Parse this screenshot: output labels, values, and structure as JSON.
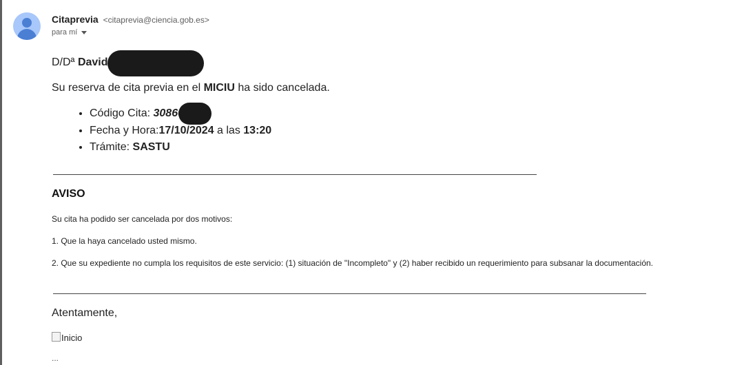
{
  "email": {
    "sender_name": "Citaprevia",
    "sender_email": "<citaprevia@ciencia.gob.es>",
    "recipient": "para mí",
    "greeting_prefix": "D/Dª",
    "greeting_name": "David",
    "line1_prefix": "Su reserva de cita previa en el",
    "line1_org": "MICIU",
    "line1_suffix": "ha sido cancelada.",
    "details": {
      "codigo_label": "Código Cita:",
      "codigo_value": "30860",
      "fecha_label": "Fecha y Hora:",
      "fecha_value": "17/10/2024",
      "fecha_mid": "a las",
      "hora_value": "13:20",
      "tramite_label": "Trámite:",
      "tramite_value": "SASTU"
    },
    "aviso_title": "AVISO",
    "aviso_intro": "Su cita ha podido ser cancelada por dos motivos:",
    "motivo1": "1. Que la haya cancelado usted mismo.",
    "motivo2": "2. Que su expediente no cumpla los requisitos de este servicio: (1) situación de \"Incompleto\" y (2) haber recibido un requerimiento para subsanar la documentación.",
    "closing": "Atentamente,",
    "image_alt": "Inicio",
    "trimmed_indicator": "..."
  }
}
